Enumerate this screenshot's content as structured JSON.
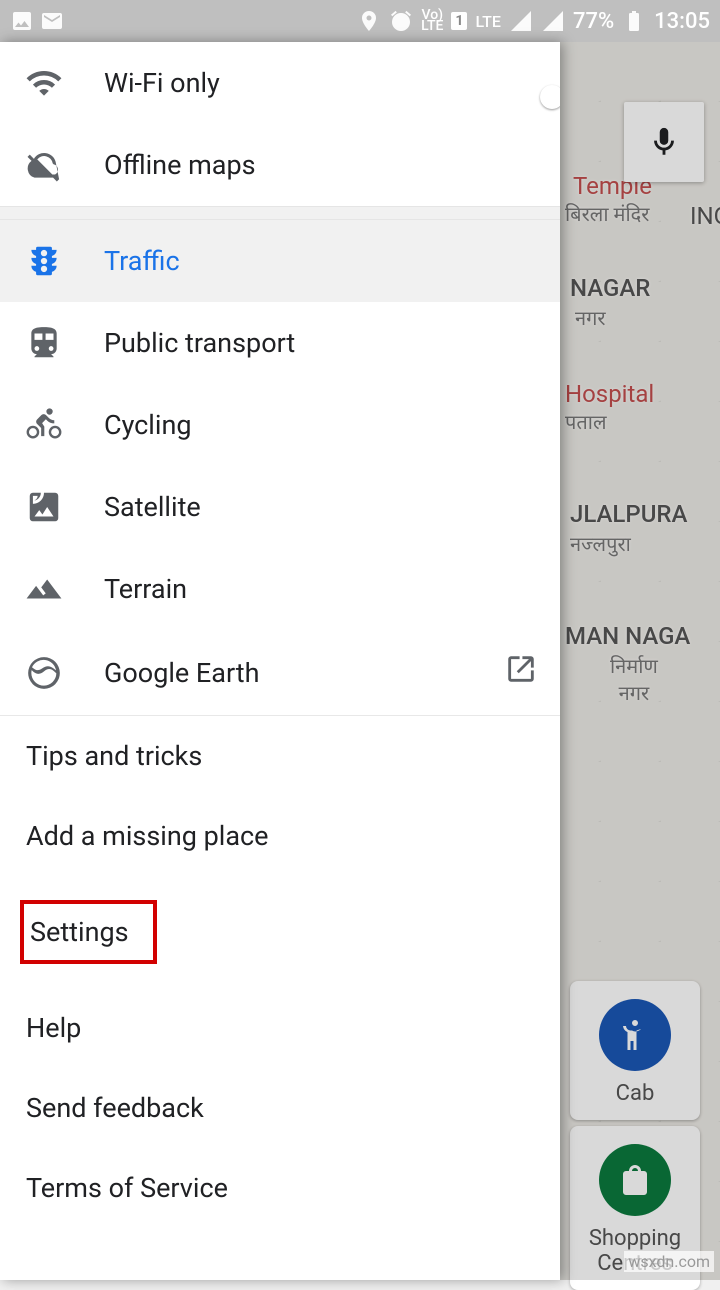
{
  "status": {
    "battery": "77%",
    "time": "13:05",
    "net": "LTE",
    "vo": "Vo)\nLTE",
    "sim": "1"
  },
  "map": {
    "labels": {
      "temple": "Temple",
      "temple_hi": "बिरला मंदिर",
      "ino": "INO",
      "nagar": "NAGAR",
      "nagar_hi": "नगर",
      "hospital": "Hospital",
      "hospital_hi": "पताल",
      "jlalpura": "JLALPURA",
      "jlalpura_hi": "नज्लपुरा",
      "man_nagar": "MAN NAGA",
      "man_nagar_hi": "निर्माण\nनगर"
    },
    "chips": {
      "cab": "Cab",
      "shopping": "Shopping\nCentres"
    }
  },
  "drawer": {
    "wifi_only": "Wi-Fi only",
    "offline_maps": "Offline maps",
    "traffic": "Traffic",
    "public_transport": "Public transport",
    "cycling": "Cycling",
    "satellite": "Satellite",
    "terrain": "Terrain",
    "google_earth": "Google Earth",
    "tips": "Tips and tricks",
    "add_place": "Add a missing place",
    "settings": "Settings",
    "help": "Help",
    "feedback": "Send feedback",
    "tos": "Terms of Service"
  },
  "watermark": "wsxdn.com"
}
